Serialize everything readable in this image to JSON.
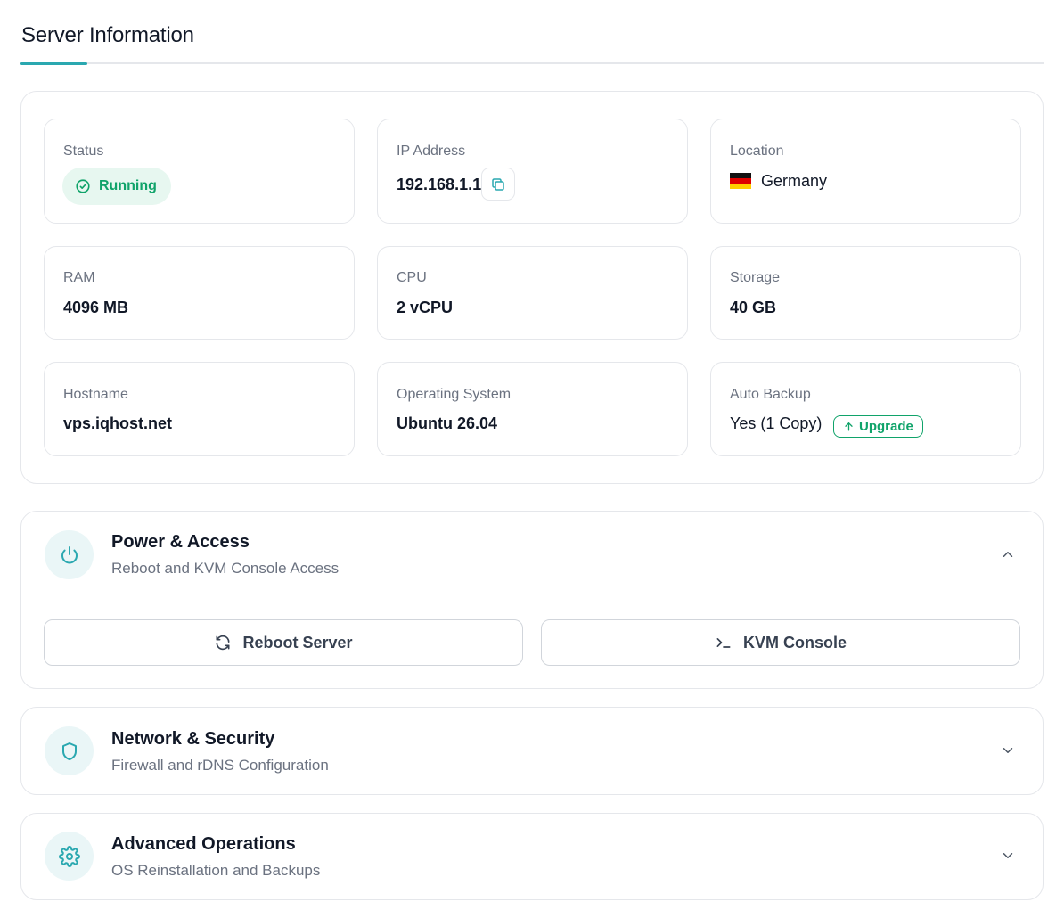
{
  "page": {
    "title": "Server Information"
  },
  "server": {
    "status": {
      "label": "Status",
      "value": "Running"
    },
    "ip": {
      "label": "IP Address",
      "value": "192.168.1.1"
    },
    "location": {
      "label": "Location",
      "value": "Germany"
    },
    "ram": {
      "label": "RAM",
      "value": "4096 MB"
    },
    "cpu": {
      "label": "CPU",
      "value": "2 vCPU"
    },
    "storage": {
      "label": "Storage",
      "value": "40 GB"
    },
    "hostname": {
      "label": "Hostname",
      "value": "vps.iqhost.net"
    },
    "os": {
      "label": "Operating System",
      "value": "Ubuntu 26.04"
    },
    "backup": {
      "label": "Auto Backup",
      "value": "Yes (1 Copy)",
      "upgrade_label": "Upgrade"
    }
  },
  "sections": {
    "power": {
      "title": "Power & Access",
      "subtitle": "Reboot and KVM Console Access",
      "expanded": true,
      "reboot_label": "Reboot Server",
      "kvm_label": "KVM Console"
    },
    "network": {
      "title": "Network & Security",
      "subtitle": "Firewall and rDNS Configuration",
      "expanded": false
    },
    "advanced": {
      "title": "Advanced Operations",
      "subtitle": "OS Reinstallation and Backups",
      "expanded": false
    }
  },
  "icons": {
    "status": "check-circle-icon",
    "copy": "copy-icon",
    "flag": "germany-flag-icon",
    "upgrade": "arrow-up-icon",
    "power": "power-icon",
    "network": "shield-icon",
    "advanced": "gear-icon",
    "reboot": "refresh-icon",
    "kvm": "terminal-icon",
    "chevron_up": "chevron-up-icon",
    "chevron_down": "chevron-down-icon"
  },
  "colors": {
    "accent": "#2aa8b0",
    "success": "#10a36a",
    "success_bg": "#e7f7f0",
    "icon_bg": "#eaf6f7",
    "border": "#e5e7eb",
    "text": "#111827",
    "muted": "#6b7280"
  }
}
